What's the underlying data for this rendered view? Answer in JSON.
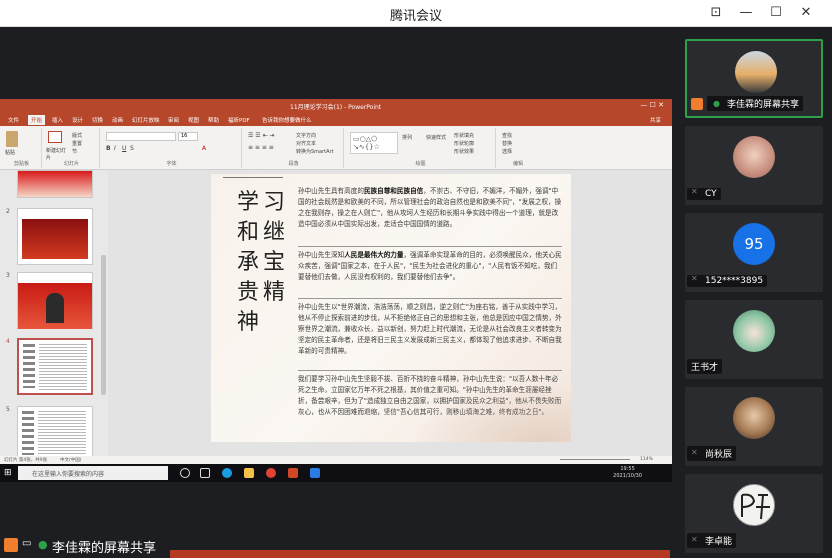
{
  "window": {
    "title": "腾讯会议"
  },
  "share": {
    "title": "11月理论学习会(1) - PowerPoint",
    "tabs": [
      "文件",
      "开始",
      "插入",
      "设计",
      "切换",
      "动画",
      "幻灯片放映",
      "审阅",
      "视图",
      "帮助",
      "福昕PDF",
      "告诉我你想要做什么",
      "共享"
    ],
    "ribbon": {
      "groups": [
        "剪贴板",
        "幻灯片",
        "字体",
        "段落",
        "绘图",
        "编辑"
      ],
      "buttons": [
        "粘贴",
        "新建幻灯片",
        "重用幻灯片",
        "版式",
        "重置",
        "节",
        "文字方向",
        "对齐文本",
        "转换为SmartArt",
        "排列",
        "快速样式",
        "形状填充",
        "形状轮廓",
        "形状效果",
        "查找",
        "替换",
        "选择"
      ],
      "font_size": "16"
    },
    "thumbnails": [
      {
        "num": "2"
      },
      {
        "num": "3"
      },
      {
        "num": "4"
      },
      {
        "num": "5"
      }
    ],
    "slide": {
      "title_col1": "学和承贵神",
      "title_col2": "习继宝精",
      "p1_lead": "孙中山先生具有高度的",
      "p1_bold": "民族自尊和民族自信",
      "p1_rest": "，不崇古、不守旧，不媚洋，不媚外，强调\"中国的社会既然是和欧美的不同，所以管理社会的政治自然也是和欧美不同\"，\"发展之权，操之在我则存，操之在人则亡\"，他从攻坷人生经历和长期斗争实践中得出一个道理，就是改造中国必须从中国实际出发，走适合中国国情的道路。",
      "p2_lead": "孙中山先生深知",
      "p2_bold": "人民是最伟大的力量",
      "p2_rest": "，强调革命实现革命的目的，必须唤醒民众，他关心民众疾苦，强调\"国家之本，在于人民\"，\"民生为社会进化的重心\"，\"人民有饭不知吃，我们要替他们去做，人民没有权利的，我们要替他们去争\"。",
      "p3": "孙中山先生以\"世界潮流，浩浩荡荡，顺之则昌，逆之则亡\"为座右铭，善于从实践中学习，他从不停止探索前进的步伐，从不拒绝修正自己的思想和主张，他总是因应中国之情势，外察世界之潮流，兼收众长，益以新创，努力赶上时代潮流，无论是从社会改良主义者转变为坚定的民主革命者，还是将旧三民主义发展成新三民主义，都体现了他追求进步、不断自我革新的可贵精神。",
      "p4": "我们要学习孙中山先生坚毅不拔、百折不挠的奋斗精神，孙中山先生说：\"以吾人数十年必死之生命，立国家亿万年不死之根基，其价值之重可知。\"孙中山先生的革命生涯屡经挫折，备尝艰辛，但为了\"造成独立自由之国家，以拥护国家及民众之利益\"，他从不畏失败而灰心，也从不因困难而退缩，坚信\"吾心信其可行，则移山填海之难，终有成功之日\"。"
    },
    "status": {
      "slide_count": "幻灯片 第4张，共9张",
      "language": "中文(中国)",
      "zoom": "114%"
    },
    "taskbar": {
      "search_placeholder": "在这里输入你要搜索的内容",
      "time": "19:55",
      "date": "2021/10/30"
    }
  },
  "banner": {
    "label": "李佳霖的屏幕共享"
  },
  "participants": [
    {
      "name": "李佳霖的屏幕共享",
      "avatar": "sunset-photo"
    },
    {
      "name": "CY",
      "avatar": "cartoon-photo"
    },
    {
      "name": "152****3895",
      "avatar_text": "95"
    },
    {
      "name": "王书才",
      "avatar": "anime-photo"
    },
    {
      "name": "尚秋辰",
      "avatar": "portrait-photo"
    },
    {
      "name": "李卓能",
      "avatar": "calligraphy-photo"
    }
  ],
  "colors": {
    "powerpoint_red": "#b7472a",
    "active_border": "#2ea048",
    "avatar_blue": "#1672e6",
    "share_icon_orange": "#f07e2c"
  }
}
